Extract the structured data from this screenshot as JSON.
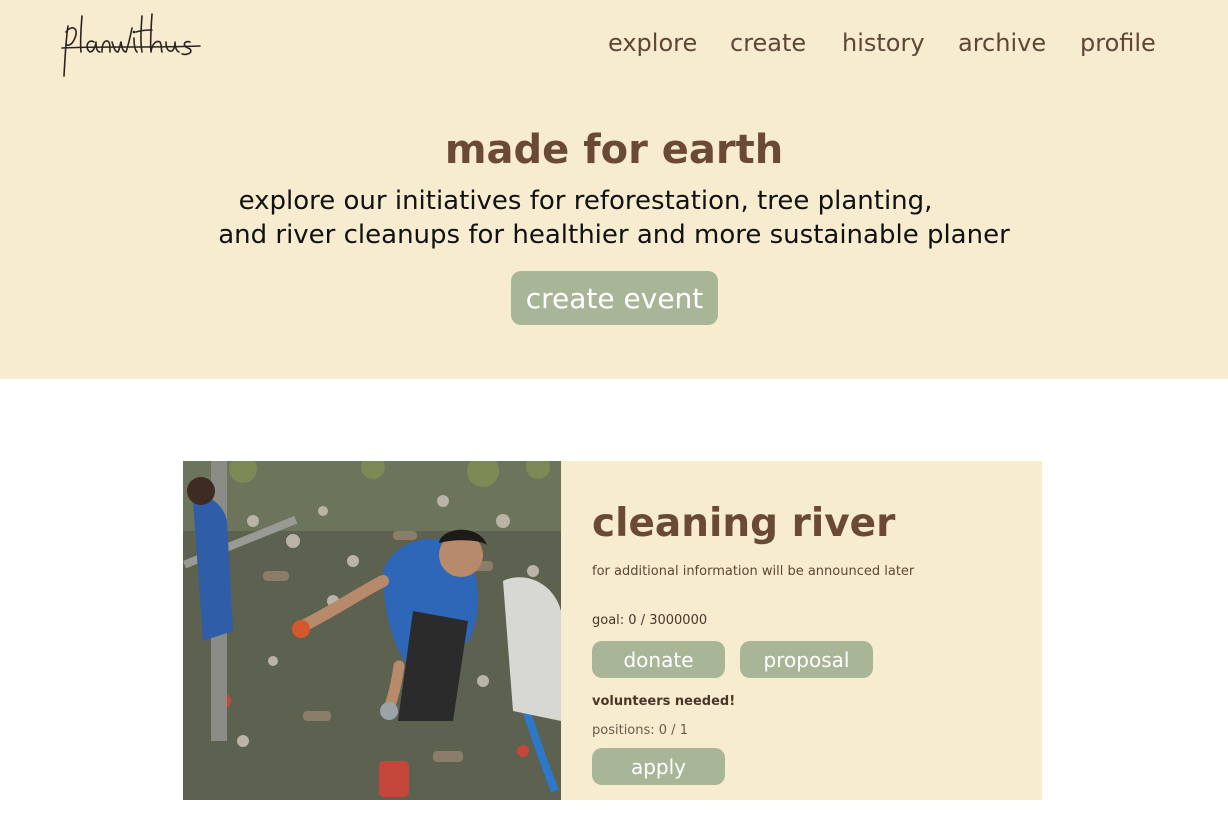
{
  "brand": {
    "logo_text": "planwithus"
  },
  "nav": {
    "items": [
      {
        "label": "explore"
      },
      {
        "label": "create"
      },
      {
        "label": "history"
      },
      {
        "label": "archive"
      },
      {
        "label": "profile"
      }
    ]
  },
  "hero": {
    "title": "made for earth",
    "subtitle_line1": "explore our initiatives for reforestation, tree planting,",
    "subtitle_line2": "and river cleanups for healthier and more sustainable planer",
    "cta_label": "create event"
  },
  "event": {
    "title": "cleaning river",
    "description": "for additional information will be announced later",
    "goal_text": "goal: 0 / 3000000",
    "donate_label": "donate",
    "proposal_label": "proposal",
    "volunteers_text": "volunteers needed!",
    "positions_text": "positions: 0 / 1",
    "apply_label": "apply",
    "image_alt": "volunteers cleaning trash from a river"
  },
  "colors": {
    "hero_bg": "#f7ecd0",
    "accent_button": "#a8b597",
    "heading_brown": "#6a4a36",
    "nav_text": "#5f4636"
  }
}
